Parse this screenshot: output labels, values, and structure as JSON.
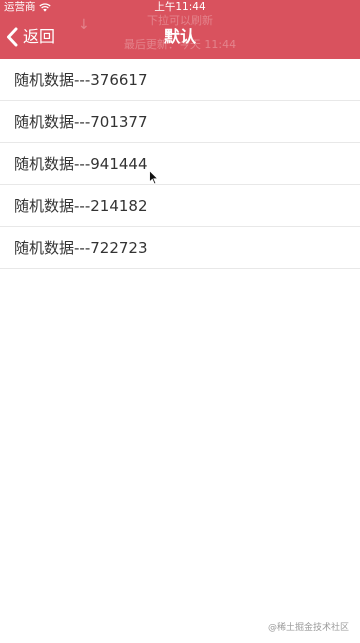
{
  "status_bar": {
    "carrier": "运营商",
    "time": "上午11:44"
  },
  "refresh_header": {
    "title": "下拉可以刷新",
    "time": "最后更新：今天 11:44"
  },
  "nav": {
    "back_label": "返回",
    "title": "默认"
  },
  "list": {
    "items": [
      "随机数据---376617",
      "随机数据---701377",
      "随机数据---941444",
      "随机数据---214182",
      "随机数据---722723"
    ]
  },
  "watermark": "@稀土掘金技术社区",
  "colors": {
    "header_bg": "#d9525e",
    "header_text": "#ffffff",
    "list_text": "#333333",
    "divider": "#e8e8e8"
  },
  "icons": {
    "wifi": "wifi-icon",
    "back": "chevron-left-icon",
    "cursor": "mouse-pointer-icon",
    "pull_arrow": "arrow-down-icon"
  }
}
